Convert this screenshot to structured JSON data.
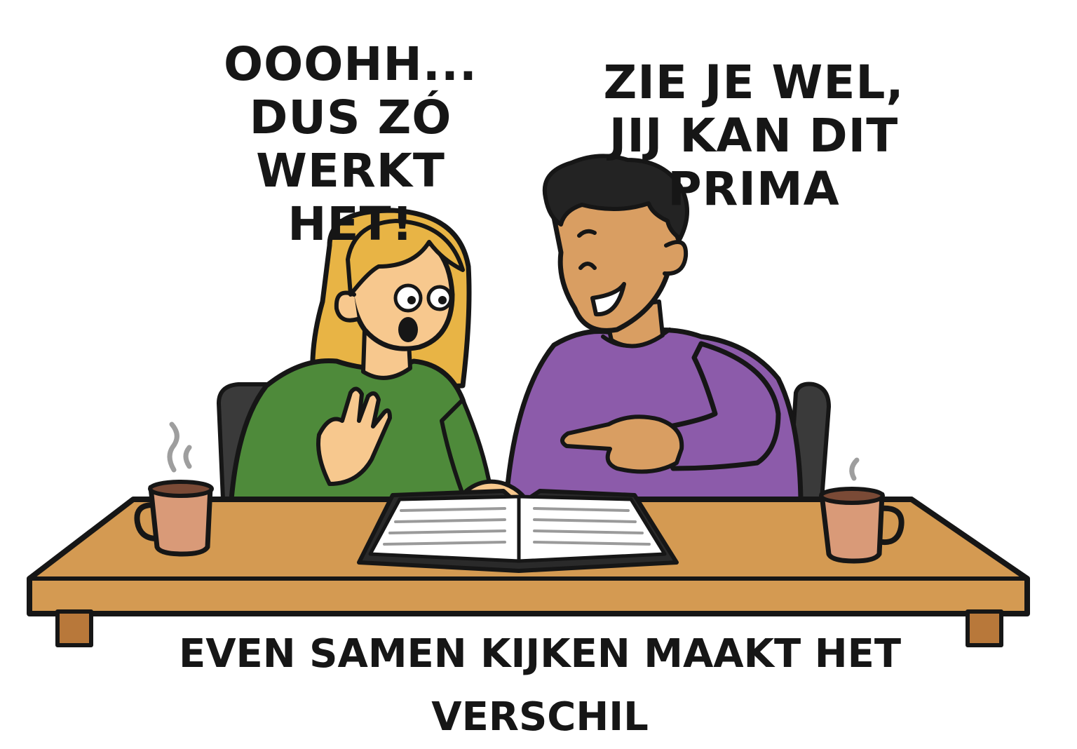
{
  "speech_woman": {
    "line1": "OOOHH...",
    "line2": "DUS ZÓ",
    "line3": "WERKT HET!"
  },
  "speech_man": {
    "line1": "ZIE JE WEL,",
    "line2": "JIJ KAN DIT",
    "line3": "PRIMA"
  },
  "footer_caption": "EVEN SAMEN KIJKEN MAAKT HET VERSCHIL",
  "colors": {
    "outline": "#161616",
    "table": "#D49A52",
    "table_edge": "#B8783A",
    "woman_sweater": "#4E8A3A",
    "woman_hair": "#E8B445",
    "woman_skin": "#F7C88E",
    "man_sweater": "#8C5BAA",
    "man_hair": "#232323",
    "man_skin": "#D99E62",
    "mug": "#D99A78",
    "chair": "#3A3A3A",
    "book_page": "#FFFFFF"
  },
  "icons": [
    "coffee-mug-icon",
    "open-book-icon",
    "steam-icon"
  ]
}
